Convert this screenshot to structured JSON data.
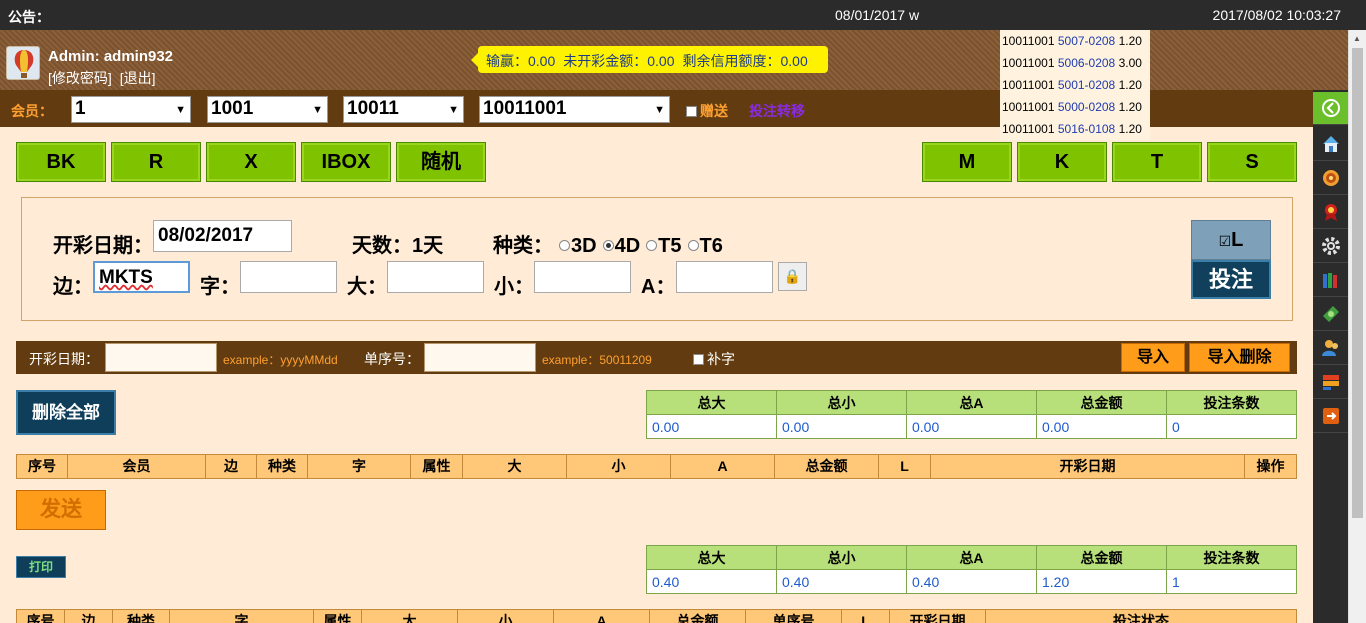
{
  "topbar": {
    "notice_label": "公告：",
    "marquee_text": "08/01/2017 w",
    "clock": "2017/08/02 10:03:27"
  },
  "header": {
    "user_name": "Admin: admin932",
    "change_password": "[修改密码]",
    "logout": "[退出]",
    "credit": {
      "winloss_label": "输赢：0.00",
      "pending_label": "未开彩金额：0.00",
      "remaining_label": "剩余信用额度：0.00"
    }
  },
  "popup": {
    "rows": [
      {
        "member": "10011001",
        "code": "5007-0208",
        "amount": "1.20"
      },
      {
        "member": "10011001",
        "code": "5006-0208",
        "amount": "3.00"
      },
      {
        "member": "10011001",
        "code": "5001-0208",
        "amount": "1.20"
      },
      {
        "member": "10011001",
        "code": "5000-0208",
        "amount": "1.20"
      },
      {
        "member": "10011001",
        "code": "5016-0108",
        "amount": "1.20"
      }
    ]
  },
  "filter": {
    "member_label": "会员：",
    "select1": "1",
    "select2": "1001",
    "select3": "10011",
    "select4": "10011001",
    "gift_label": "赠送",
    "transfer_label": "投注转移"
  },
  "quick_buttons_left": [
    "BK",
    "R",
    "X",
    "IBOX",
    "随机"
  ],
  "quick_buttons_right": [
    "M",
    "K",
    "T",
    "S"
  ],
  "form": {
    "date_label": "开彩日期：",
    "date_value": "08/02/2017",
    "days_label": "天数：1天",
    "type_label": "种类：",
    "types": [
      "3D",
      "4D",
      "T5",
      "T6"
    ],
    "selected_type": "4D",
    "side_label": "边：",
    "side_value": "MKTS",
    "char_label": "字：",
    "big_label": "大：",
    "small_label": "小：",
    "a_label": "A：",
    "l_label": "L",
    "submit_label": "投注"
  },
  "import_bar": {
    "date_label": "开彩日期：",
    "date_example": "example：yyyyMMdd",
    "serial_label": "单序号：",
    "serial_example": "example：50011209",
    "supplement_label": "补字",
    "import_button": "导入",
    "import_delete_button": "导入删除"
  },
  "delete_all_label": "删除全部",
  "summary_headers": [
    "总大",
    "总小",
    "总A",
    "总金额",
    "投注条数"
  ],
  "summary_top": [
    "0.00",
    "0.00",
    "0.00",
    "0.00",
    "0"
  ],
  "summary_bottom": [
    "0.40",
    "0.40",
    "0.40",
    "1.20",
    "1"
  ],
  "pending_table_headers": [
    "序号",
    "会员",
    "边",
    "种类",
    "字",
    "属性",
    "大",
    "小",
    "A",
    "总金额",
    "L",
    "开彩日期",
    "操作"
  ],
  "send_label": "发送",
  "print_label": "打印",
  "sent_table_headers": [
    "序号",
    "边",
    "种类",
    "字",
    "属性",
    "大",
    "小",
    "A",
    "总金额",
    "单序号",
    "L",
    "开彩日期",
    "投注状态"
  ],
  "sidebar_icons": [
    "back-icon",
    "home-icon",
    "settings-wheel-icon",
    "award-icon",
    "gear-icon",
    "books-icon",
    "money-icon",
    "users-icon",
    "layers-icon",
    "exit-icon"
  ],
  "colors": {
    "accent_green": "#7fc300",
    "header_brown": "#623c10",
    "orange": "#ff9d1a",
    "navy": "#0f3e5a"
  }
}
